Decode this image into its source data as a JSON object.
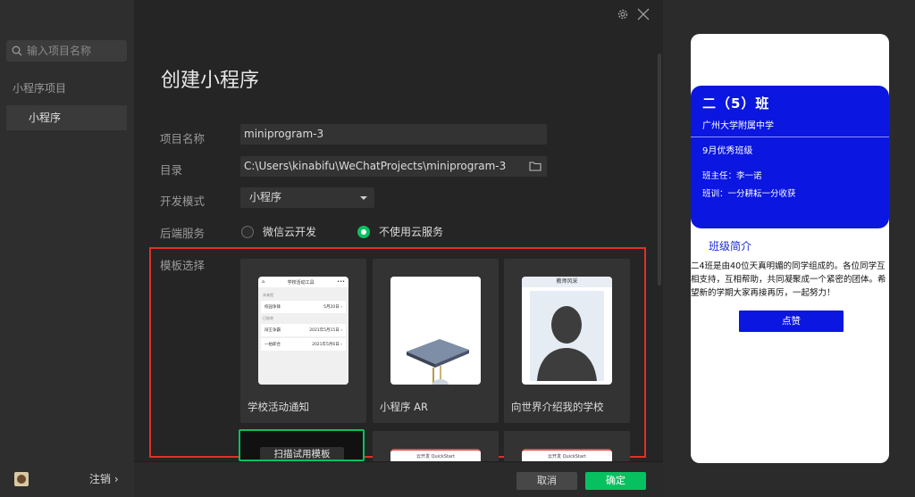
{
  "sidebar": {
    "search_placeholder": "输入项目名称",
    "section": "小程序项目",
    "active_item": "小程序",
    "logout": "注销",
    "logout_arrow": "›"
  },
  "form": {
    "title": "创建小程序",
    "project_name_label": "项目名称",
    "project_name_value": "miniprogram-3",
    "directory_label": "目录",
    "directory_value": "C:\\Users\\kinabifu\\WeChatProjects\\miniprogram-3",
    "dev_mode_label": "开发模式",
    "dev_mode_value": "小程序",
    "backend_label": "后端服务",
    "backend_options": [
      "微信云开发",
      "不使用云服务"
    ],
    "backend_selected": "不使用云服务",
    "template_label": "模板选择"
  },
  "templates": [
    {
      "name": "学校活动通知",
      "thumb_title": "学校活动工具",
      "groups": [
        {
          "group": "未来程",
          "rows": [
            [
              "校园争锋",
              "5月20日 ›"
            ]
          ]
        },
        {
          "group": "已结束",
          "rows": [
            [
              "辩王争霸",
              "2021年5月15日 ›"
            ],
            [
              "一拍即合",
              "2021年5月6日 ›"
            ]
          ]
        }
      ]
    },
    {
      "name": "小程序 AR"
    },
    {
      "name": "向世界介绍我的学校",
      "thumb_title": "教师风采"
    }
  ],
  "bottom_templates": [
    {
      "label": "扫描试用模板"
    },
    {
      "label": "云开发 QuickStart"
    },
    {
      "label": "云开发 QuickStart"
    }
  ],
  "footer": {
    "cancel": "取消",
    "confirm": "确定"
  },
  "preview": {
    "class_name": "二（5）班",
    "school": "广州大学附属中学",
    "honor": "9月优秀班级",
    "teacher": "班主任：李一诺",
    "motto": "班训：一分耕耘一分收获",
    "intro_title": "班级简介",
    "intro_text": "二4班是由40位天真明媚的同学组成的。各位同学互相支持，互相帮助，共同凝聚成一个紧密的团体。希望新的学期大家再接再厉，一起努力！",
    "like_button": "点赞"
  },
  "colors": {
    "accent_green": "#07c160",
    "highlight_red": "#e0302a",
    "preview_blue": "#0b16e0"
  }
}
